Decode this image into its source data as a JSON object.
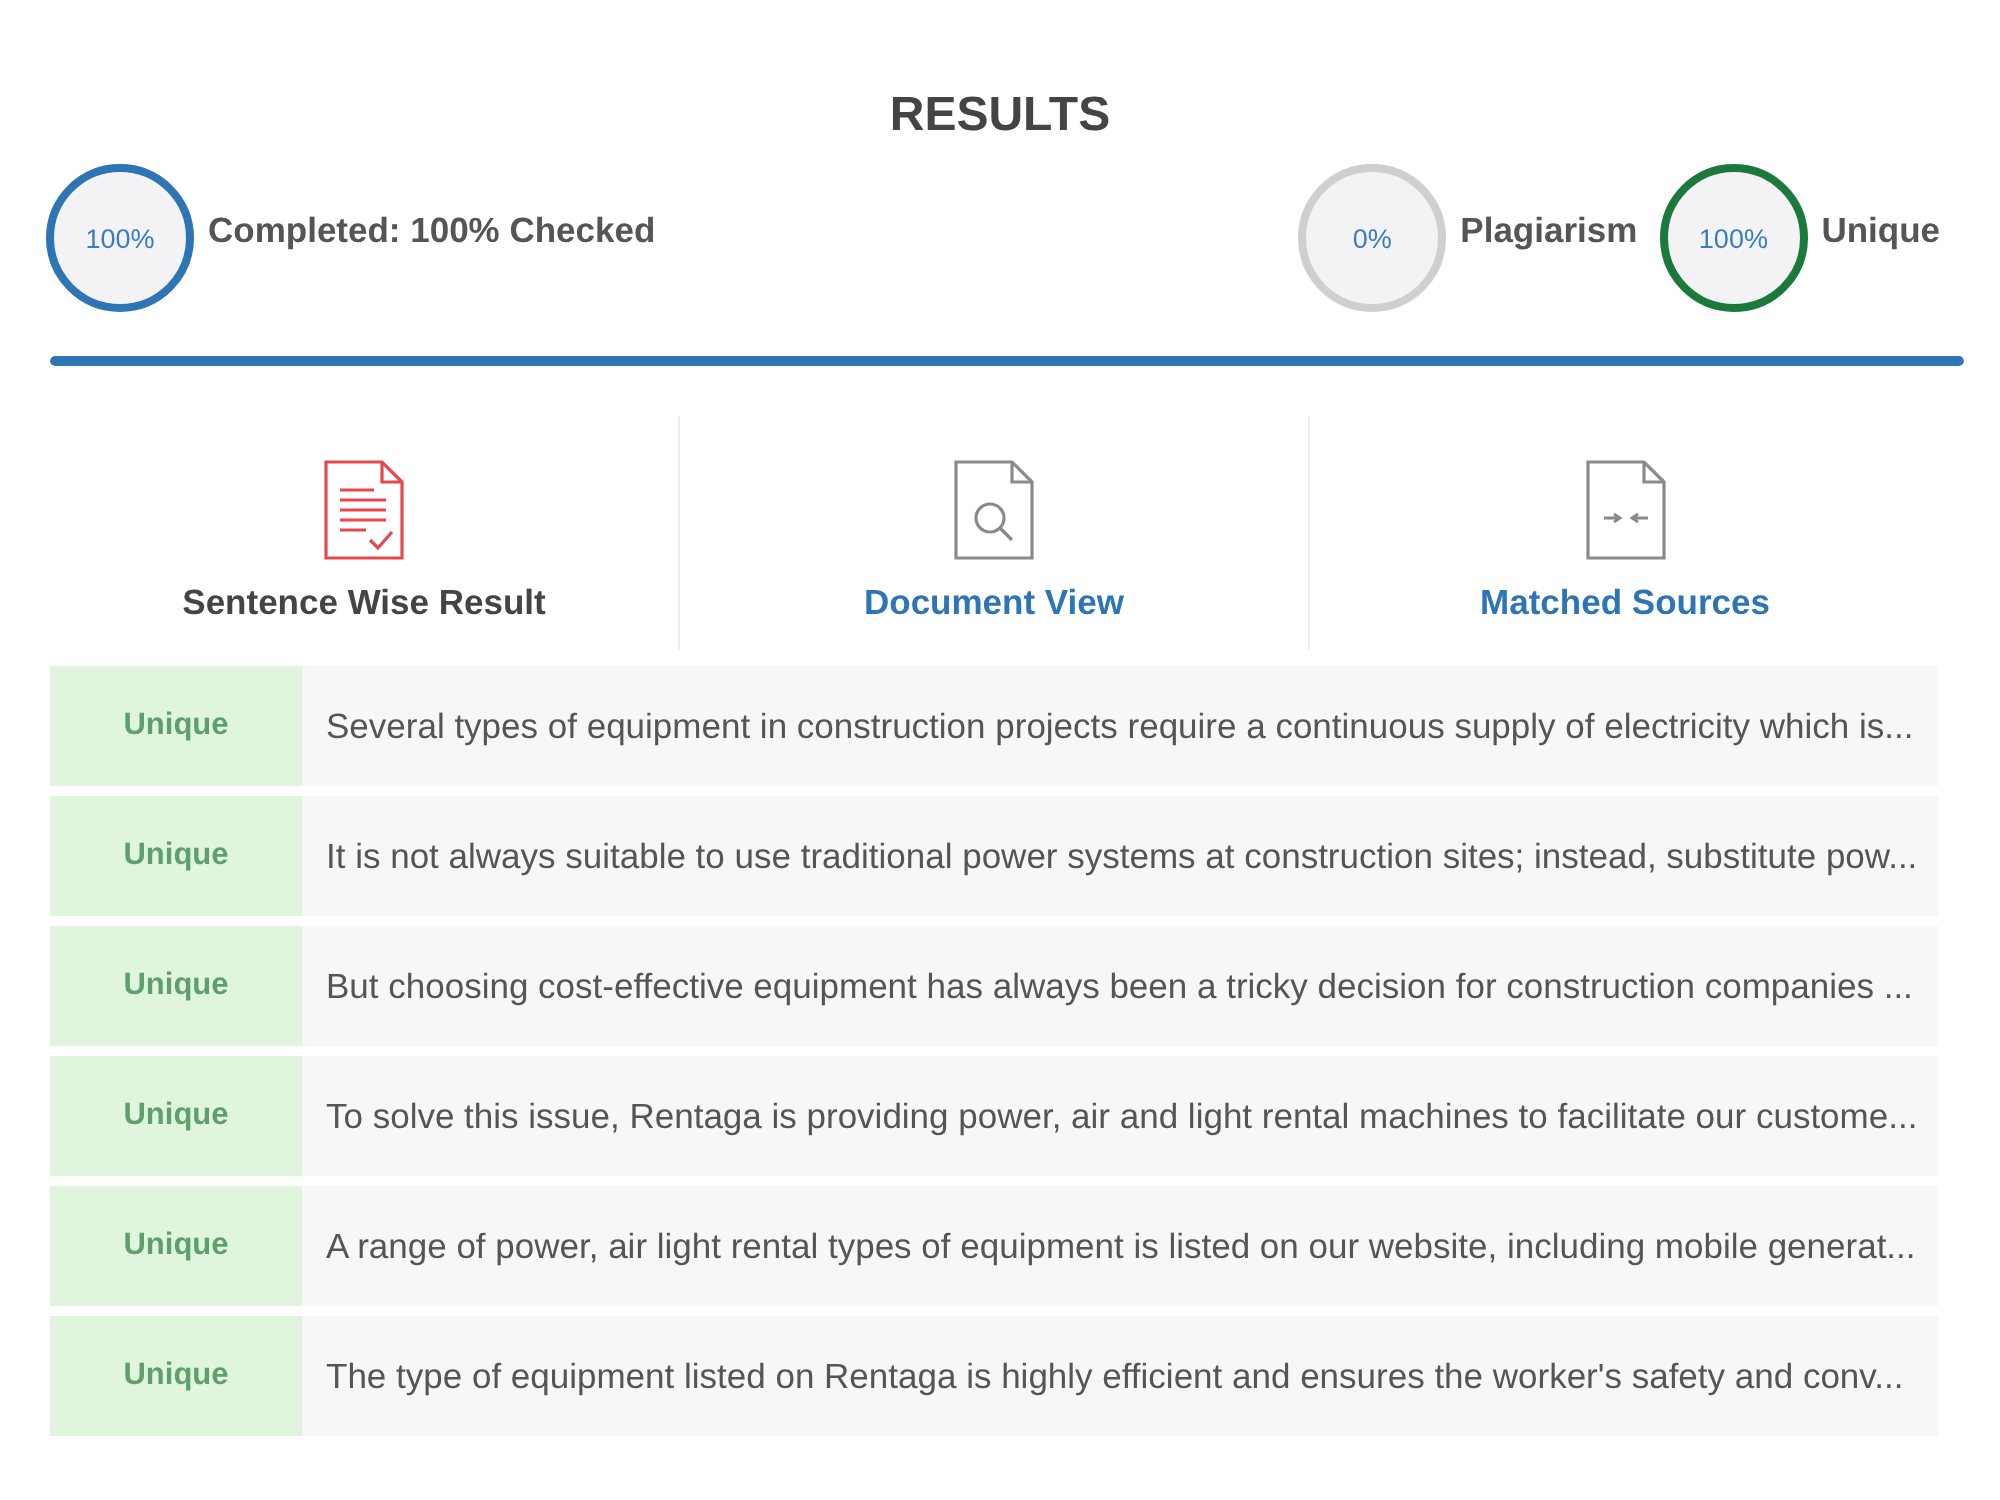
{
  "title": "RESULTS",
  "stats": [
    {
      "percent": "100%",
      "label": "Completed: 100% Checked",
      "color": "#2e75b6"
    },
    {
      "percent": "0%",
      "label": "Plagiarism",
      "color": "#cfcfcf"
    },
    {
      "percent": "100%",
      "label": "Unique",
      "color": "#1b7a3b"
    }
  ],
  "progress": {
    "level": 1
  },
  "tabs": [
    {
      "label": "Sentence Wise Result",
      "selected": true
    },
    {
      "label": "Document View",
      "selected": false
    },
    {
      "label": "Matched Sources",
      "selected": false
    }
  ],
  "rows": [
    {
      "status": "Unique",
      "text": "Several types of equipment in construction projects require a continuous supply of electricity which is..."
    },
    {
      "status": "Unique",
      "text": "It is not always suitable to use traditional power systems at construction sites; instead, substitute pow..."
    },
    {
      "status": "Unique",
      "text": "But choosing cost-effective equipment has always been a tricky decision for construction companies ..."
    },
    {
      "status": "Unique",
      "text": "To solve this issue, Rentaga is providing power, air and light rental machines to facilitate our custome..."
    },
    {
      "status": "Unique",
      "text": "A range of power, air light rental types of equipment is listed on our website, including mobile generat..."
    },
    {
      "status": "Unique",
      "text": "The type of equipment listed on Rentaga is highly efficient and ensures the worker's safety and conv..."
    }
  ]
}
